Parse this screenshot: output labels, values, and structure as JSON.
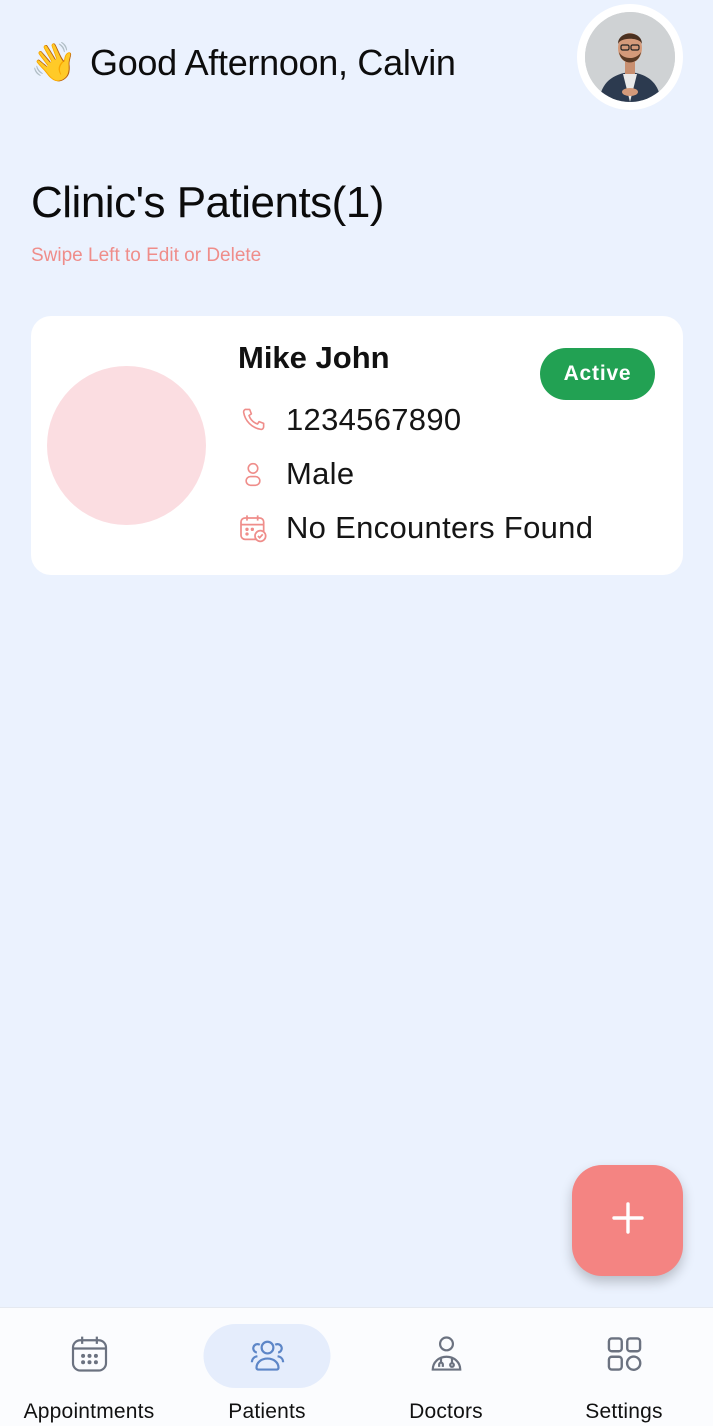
{
  "header": {
    "wave_emoji": "👋",
    "greeting": "Good Afternoon, Calvin",
    "avatar_icon": "user-avatar-photo"
  },
  "section": {
    "title": "Clinic's Patients(1)",
    "hint": "Swipe Left to Edit or Delete"
  },
  "patients": [
    {
      "name": "Mike John",
      "status": "Active",
      "phone": "1234567890",
      "gender": "Male",
      "encounters": "No Encounters Found"
    }
  ],
  "fab": {
    "icon": "plus-icon"
  },
  "nav": {
    "items": [
      {
        "label": "Appointments",
        "icon": "calendar-icon",
        "active": false
      },
      {
        "label": "Patients",
        "icon": "users-icon",
        "active": true
      },
      {
        "label": "Doctors",
        "icon": "doctor-icon",
        "active": false
      },
      {
        "label": "Settings",
        "icon": "grid-icon",
        "active": false
      }
    ]
  },
  "colors": {
    "background": "#ebf2fe",
    "accent": "#f48482",
    "status_active": "#22a153",
    "hint_text": "#ef8d8a",
    "avatar_placeholder": "#fbdde1",
    "nav_active": "#e5edfc"
  }
}
